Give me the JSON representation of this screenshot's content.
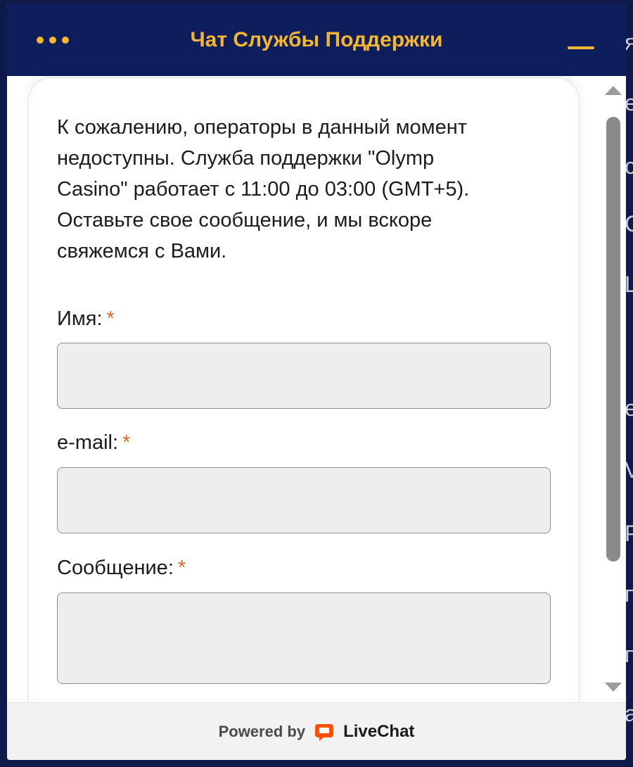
{
  "header": {
    "title": "Чат Службы Поддержки",
    "menu_icon": "more-dots-icon",
    "minimize_icon": "minimize-icon",
    "accent_color": "#f5b731",
    "background_color": "#0e1d5c"
  },
  "message": {
    "lines": [
      "К сожалению, операторы в данный момент",
      "недоступны. Служба поддержки \"Olymp",
      "Casino\" работает с 11:00 до 03:00 (GMT+5).",
      "Оставьте свое сообщение, и мы вскоре",
      "свяжемся с Вами."
    ]
  },
  "form": {
    "required_mark": "*",
    "name_label": "Имя:",
    "name_value": "",
    "email_label": "e-mail:",
    "email_value": "",
    "message_label": "Сообщение:",
    "message_value": ""
  },
  "footer": {
    "powered_by": "Powered by",
    "brand": "LiveChat",
    "brand_icon": "livechat-logo-icon",
    "brand_color": "#ff5100"
  },
  "background_page_fragments": [
    "я",
    "е",
    "с",
    "С",
    "L",
    "е",
    "V",
    "Р",
    "п",
    "п",
    "а"
  ]
}
